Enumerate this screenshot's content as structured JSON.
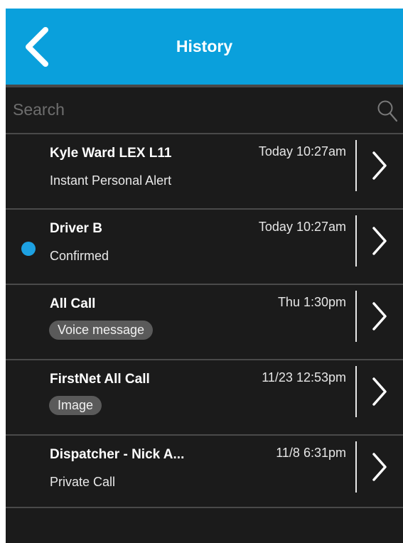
{
  "header": {
    "title": "History",
    "back_icon": "chevron-left-icon",
    "background": "#0aa0dc"
  },
  "search": {
    "placeholder": "Search",
    "value": "",
    "icon": "search-icon"
  },
  "colors": {
    "unread_dot": "#1da1e2",
    "pill_background": "#5a5a5a",
    "list_background": "#1b1b1b"
  },
  "history": [
    {
      "name": "Kyle Ward LEX L11",
      "time": "Today 10:27am",
      "subtitle": "Instant Personal Alert",
      "pill": "",
      "unread": false
    },
    {
      "name": "Driver B",
      "time": "Today 10:27am",
      "subtitle": "Confirmed",
      "pill": "",
      "unread": true
    },
    {
      "name": "All Call",
      "time": "Thu 1:30pm",
      "subtitle": "",
      "pill": "Voice message",
      "unread": false
    },
    {
      "name": "FirstNet All Call",
      "time": "11/23 12:53pm",
      "subtitle": "",
      "pill": "Image",
      "unread": false
    },
    {
      "name": "Dispatcher - Nick A...",
      "time": "11/8 6:31pm",
      "subtitle": "Private Call",
      "pill": "",
      "unread": false
    }
  ]
}
